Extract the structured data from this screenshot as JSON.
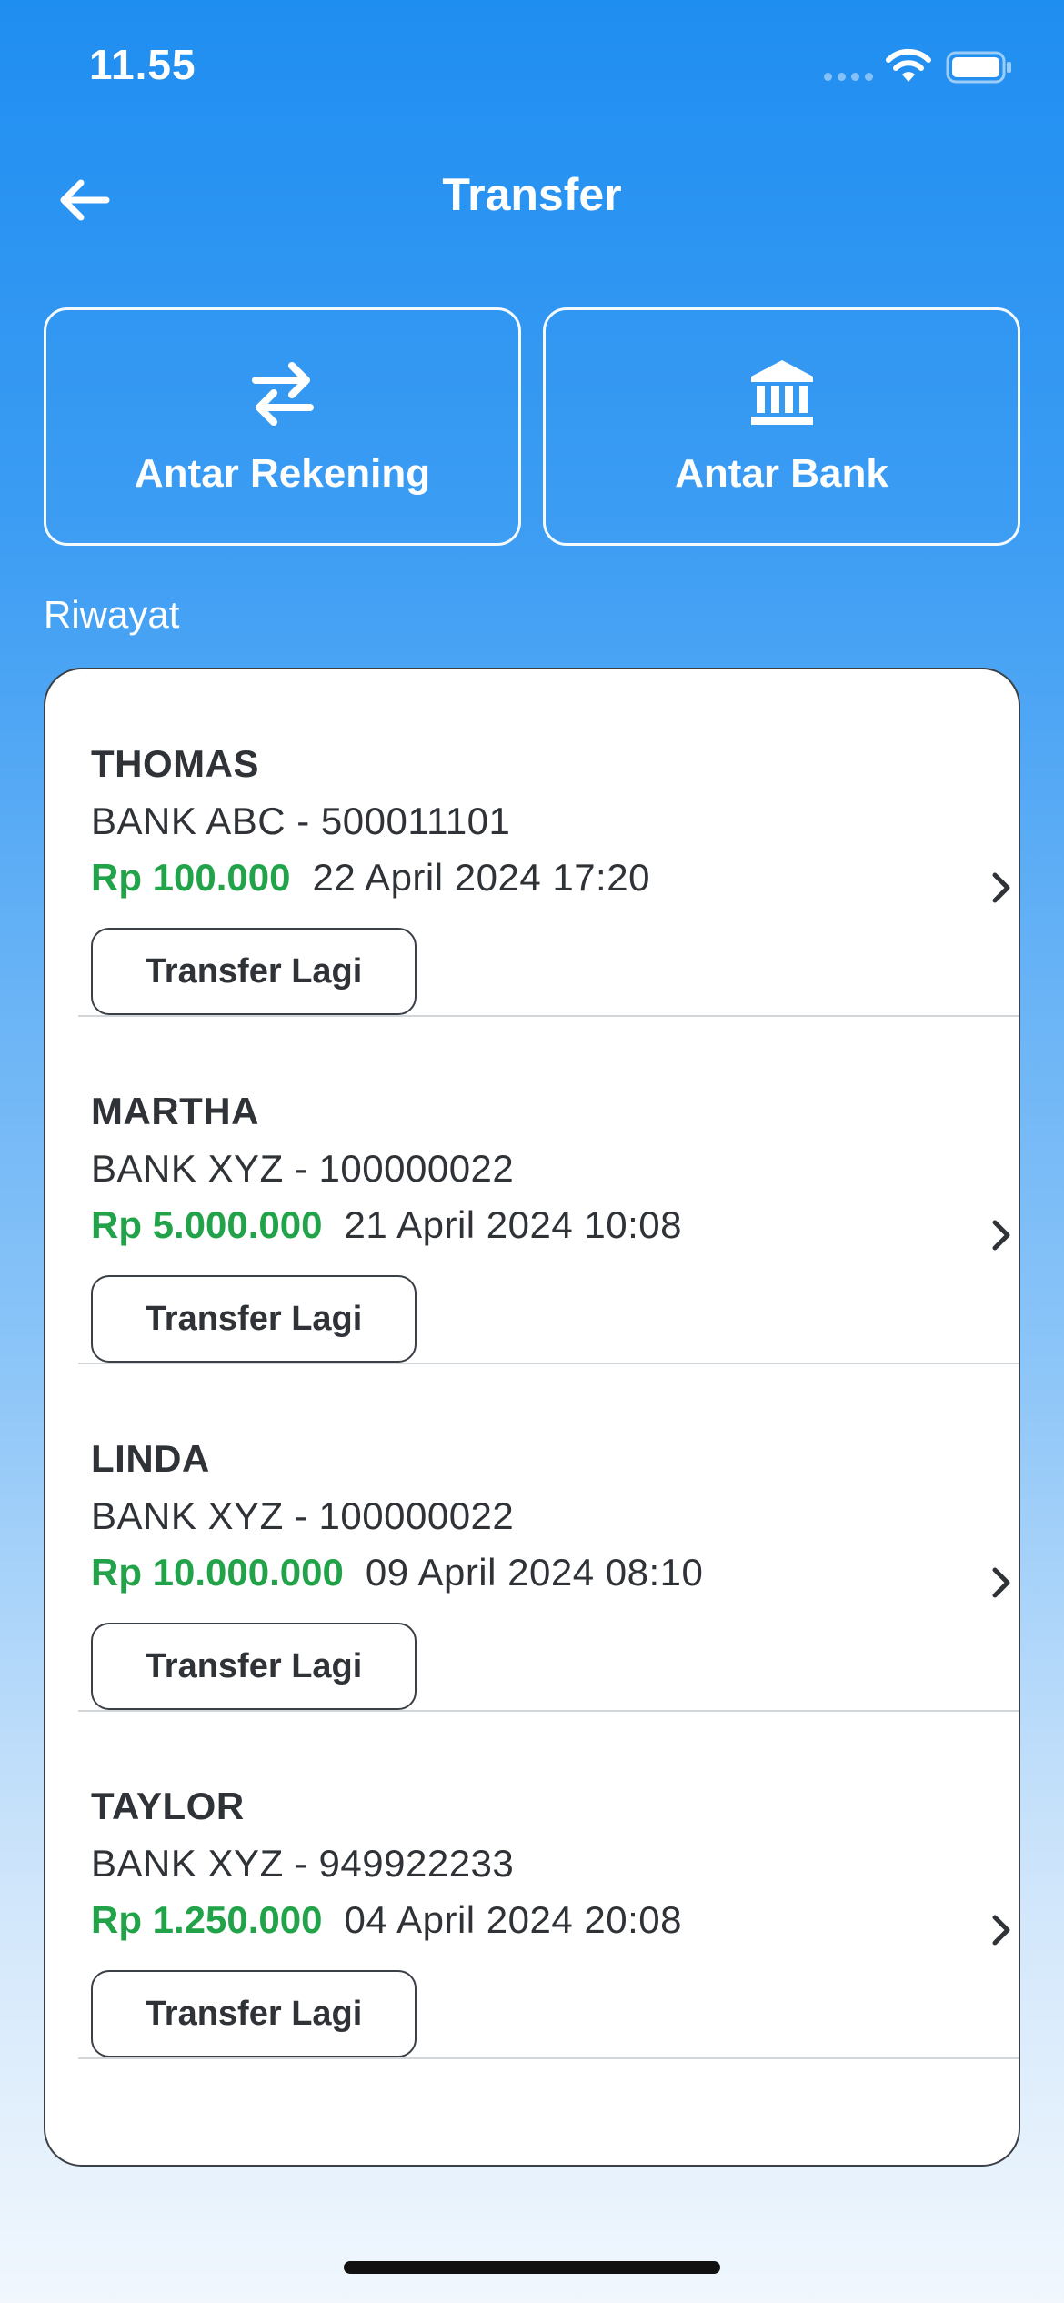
{
  "status_bar": {
    "time": "11.55"
  },
  "header": {
    "title": "Transfer",
    "back_icon": "arrow-left-icon"
  },
  "actions": [
    {
      "label": "Antar Rekening",
      "icon": "swap-arrows-icon"
    },
    {
      "label": "Antar Bank",
      "icon": "bank-building-icon"
    }
  ],
  "history": {
    "label": "Riwayat",
    "items": [
      {
        "name": "THOMAS",
        "account": "BANK ABC - 500011101",
        "amount": "Rp 100.000",
        "datetime": "22 April 2024 17:20",
        "button_label": "Transfer Lagi"
      },
      {
        "name": "MARTHA",
        "account": "BANK XYZ - 100000022",
        "amount": "Rp 5.000.000",
        "datetime": "21 April 2024 10:08",
        "button_label": "Transfer Lagi"
      },
      {
        "name": "LINDA",
        "account": "BANK XYZ - 100000022",
        "amount": "Rp 10.000.000",
        "datetime": "09 April 2024 08:10",
        "button_label": "Transfer Lagi"
      },
      {
        "name": "TAYLOR",
        "account": "BANK XYZ - 949922233",
        "amount": "Rp 1.250.000",
        "datetime": "04 April 2024 20:08",
        "button_label": "Transfer Lagi"
      }
    ]
  },
  "colors": {
    "primary": "#1f8ef1",
    "amount": "#22a34a",
    "text": "#2f3337"
  }
}
